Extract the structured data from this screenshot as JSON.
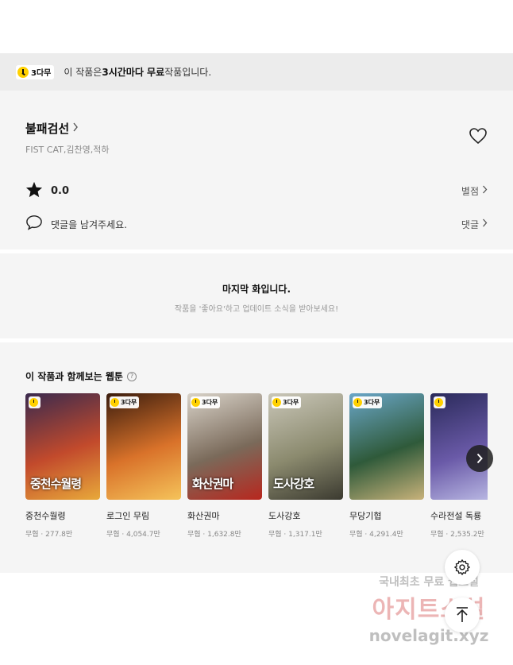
{
  "banner": {
    "badge": "3다무",
    "prefix": "이 작품은 ",
    "highlight": "3시간마다 무료",
    "suffix": " 작품입니다."
  },
  "work": {
    "title": "불패검선",
    "authors": "FIST CAT,김찬영,적하",
    "rating": "0.0",
    "rating_link": "별점",
    "comment_placeholder": "댓글을 남겨주세요.",
    "comment_link": "댓글"
  },
  "end_notice": {
    "title": "마지막 화입니다.",
    "subtitle": "작품을 '좋아요'하고 업데이트 소식을 받아보세요!"
  },
  "recommend": {
    "title": "이 작품과 함께보는 웹툰",
    "help_icon": "?",
    "items": [
      {
        "title": "중천수월령",
        "meta": "무협 · 277.8만",
        "badge": "",
        "logo": "중천수월령",
        "colors": [
          "#3a2a4e",
          "#c24a2c",
          "#e8a93a"
        ]
      },
      {
        "title": "로그인 무림",
        "meta": "무협 · 4,054.7만",
        "badge": "3다무",
        "logo": "",
        "colors": [
          "#3b1d0e",
          "#d9722a",
          "#f5c35a"
        ]
      },
      {
        "title": "화산권마",
        "meta": "무협 · 1,632.8만",
        "badge": "3다무",
        "logo": "화산권마",
        "colors": [
          "#d8d2c8",
          "#7a6a5a",
          "#b8271e"
        ]
      },
      {
        "title": "도사강호",
        "meta": "무협 · 1,317.1만",
        "badge": "3다무",
        "logo": "도사강호",
        "colors": [
          "#c9c6b8",
          "#8b8a6e",
          "#3b3a30"
        ]
      },
      {
        "title": "무당기협",
        "meta": "무협 · 4,291.4만",
        "badge": "3다무",
        "logo": "",
        "colors": [
          "#6aa6c8",
          "#2f5a3a",
          "#c8b27a"
        ]
      },
      {
        "title": "수라전설 독룡",
        "meta": "무협 · 2,535.2만",
        "badge": "",
        "logo": "",
        "colors": [
          "#2a2a5a",
          "#6a5aa8",
          "#c0c0e8"
        ]
      }
    ]
  },
  "watermark": {
    "line1": "국내최초 무료 웹소설",
    "line2": "아지트소설",
    "line3": "novelagit.xyz"
  }
}
